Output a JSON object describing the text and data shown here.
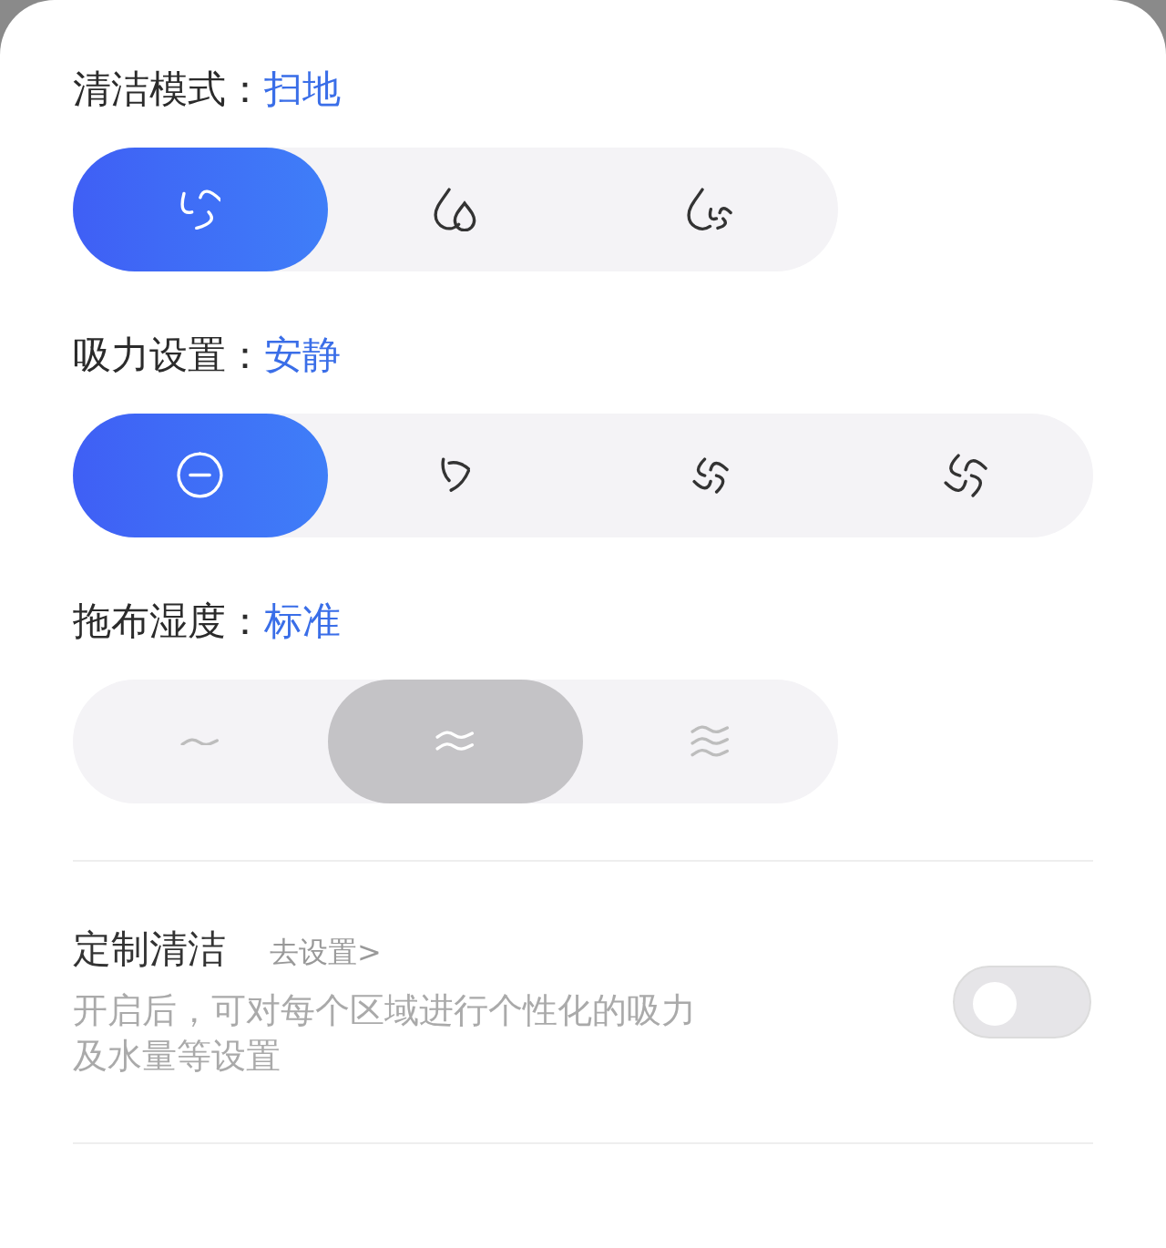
{
  "sections": [
    {
      "label": "清洁模式：",
      "value": "扫地",
      "kind": "accent",
      "options": [
        {
          "kind": "fan",
          "selected": true
        },
        {
          "kind": "drops",
          "selected": false
        },
        {
          "kind": "dropfan",
          "selected": false
        }
      ]
    },
    {
      "label": "吸力设置：",
      "value": "安静",
      "kind": "accent",
      "options": [
        {
          "kind": "quiet",
          "selected": true
        },
        {
          "kind": "standard",
          "selected": false
        },
        {
          "kind": "strong",
          "selected": false
        },
        {
          "kind": "max",
          "selected": false
        }
      ]
    },
    {
      "label": "拖布湿度：",
      "value": "标准",
      "kind": "muted",
      "options": [
        {
          "kind": "low",
          "selected": false
        },
        {
          "kind": "medium",
          "selected": true
        },
        {
          "kind": "high",
          "selected": false
        }
      ]
    }
  ],
  "custom": {
    "title": "定制清洁",
    "link": "去设置>",
    "description": "开启后，可对每个区域进行个性化的吸力及水量等设置",
    "on": false
  }
}
